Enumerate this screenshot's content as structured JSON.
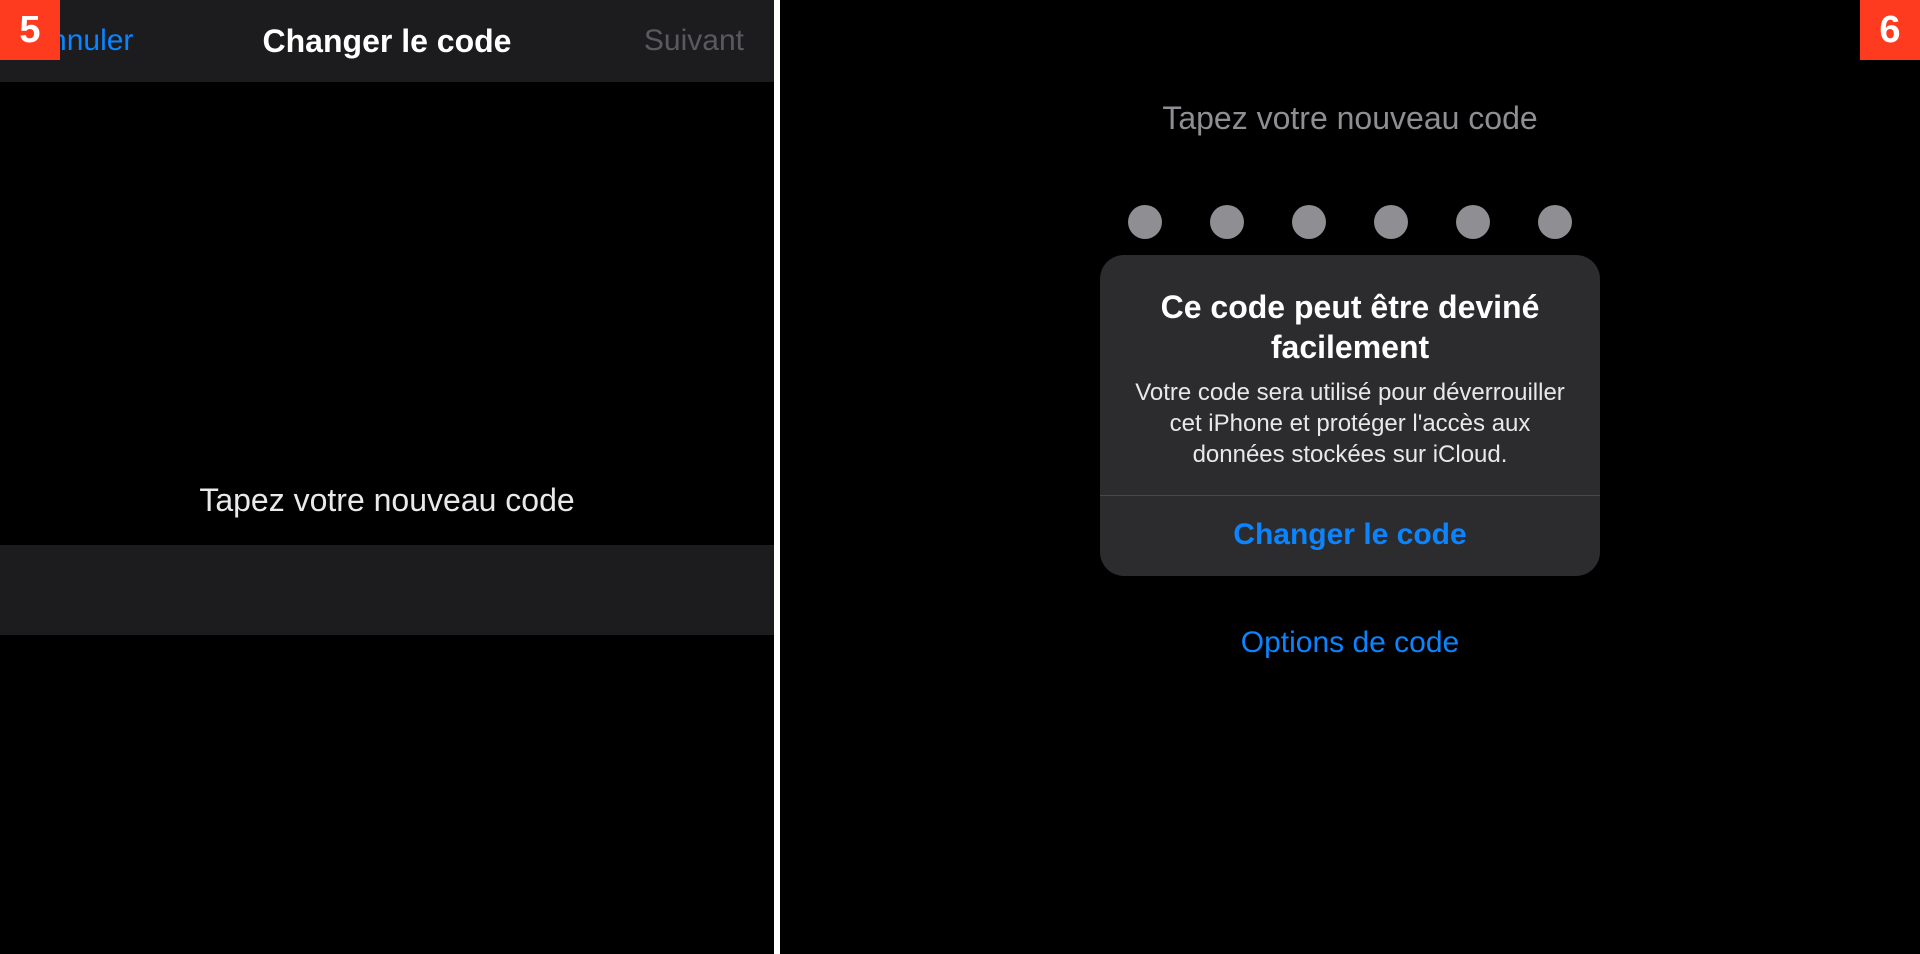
{
  "step_left": "5",
  "step_right": "6",
  "left": {
    "cancel": "Annuler",
    "title": "Changer le code",
    "next": "Suivant",
    "prompt": "Tapez votre nouveau code"
  },
  "right": {
    "prompt": "Tapez votre nouveau code",
    "passcode_length": 6,
    "alert": {
      "title": "Ce code peut être deviné facilement",
      "message": "Votre code sera utilisé pour déverrouiller cet iPhone et protéger l'accès aux données stockées sur iCloud.",
      "button": "Changer le code"
    },
    "options": "Options de code"
  }
}
